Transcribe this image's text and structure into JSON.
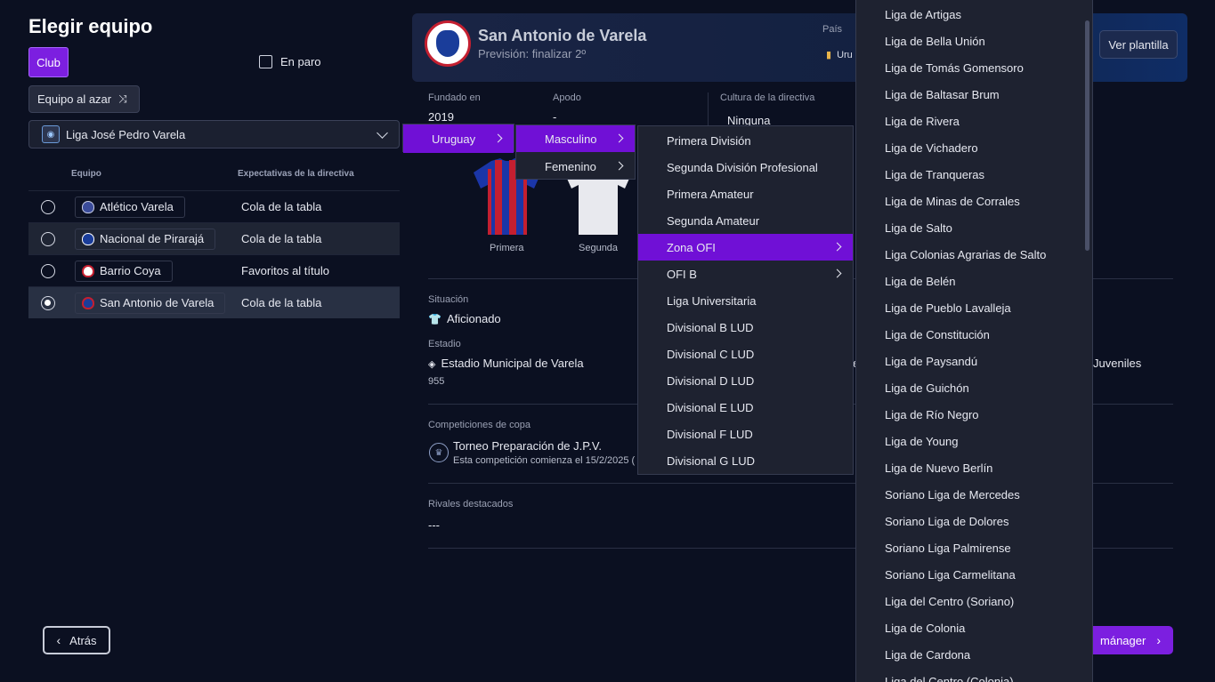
{
  "page": {
    "title": "Elegir equipo",
    "club_chip": "Club",
    "unemployed": "En paro",
    "random_team": "Equipo al azar",
    "league": "Liga José Pedro Varela",
    "back": "Atrás",
    "next": "mánager"
  },
  "table": {
    "col_team": "Equipo",
    "col_expect": "Expectativas de la directiva",
    "rows": [
      {
        "team": "Atlético Varela",
        "expect": "Cola de la tabla",
        "selected": false,
        "crest_color": "#3a4b9a"
      },
      {
        "team": "Nacional de Pirarajá",
        "expect": "Cola de la tabla",
        "selected": false,
        "crest_color": "#1a3d9a"
      },
      {
        "team": "Barrio Coya",
        "expect": "Favoritos al título",
        "selected": false,
        "crest_color": "#c41f30"
      },
      {
        "team": "San Antonio de Varela",
        "expect": "Cola de la tabla",
        "selected": true,
        "crest_color": "#c41f30"
      }
    ]
  },
  "club": {
    "name": "San Antonio de Varela",
    "prediction": "Previsión: finalizar 2º",
    "country_label": "País",
    "country_value": "Uru",
    "view_squad": "Ver plantilla",
    "founded_label": "Fundado en",
    "founded_value": "2019",
    "nickname_label": "Apodo",
    "nickname_value": "-",
    "culture_label": "Cultura de la directiva",
    "culture_value": "Ninguna",
    "kit_home": "Primera",
    "kit_away": "Segunda",
    "status_label": "Situación",
    "status_value": "Aficionado",
    "stadium_label": "Estadio",
    "stadium_value": "Estadio Municipal de Varela",
    "capacity": "955",
    "partial_right": "e",
    "youth_partial": "Juveniles",
    "cup_label": "Competiciones de copa",
    "cup_name": "Torneo Preparación de J.P.V.",
    "cup_note": "Esta competición comienza el 15/2/2025 (",
    "rivals_label": "Rivales destacados",
    "rivals_value": "---"
  },
  "menus": {
    "level1": [
      {
        "label": "Uruguay"
      }
    ],
    "level2": [
      {
        "label": "Masculino"
      },
      {
        "label": "Femenino"
      }
    ],
    "level3": [
      {
        "label": "Primera División"
      },
      {
        "label": "Segunda División Profesional"
      },
      {
        "label": "Primera Amateur"
      },
      {
        "label": "Segunda Amateur"
      },
      {
        "label": "Zona OFI"
      },
      {
        "label": "OFI B"
      },
      {
        "label": "Liga Universitaria"
      },
      {
        "label": "Divisional B LUD"
      },
      {
        "label": "Divisional C LUD"
      },
      {
        "label": "Divisional D LUD"
      },
      {
        "label": "Divisional E LUD"
      },
      {
        "label": "Divisional F LUD"
      },
      {
        "label": "Divisional G LUD"
      }
    ],
    "level4": [
      {
        "label": "Liga de Artigas"
      },
      {
        "label": "Liga de Bella Unión"
      },
      {
        "label": "Liga de Tomás Gomensoro"
      },
      {
        "label": "Liga de Baltasar Brum"
      },
      {
        "label": "Liga de Rivera"
      },
      {
        "label": "Liga de Vichadero"
      },
      {
        "label": "Liga de Tranqueras"
      },
      {
        "label": "Liga de Minas de Corrales"
      },
      {
        "label": "Liga de Salto"
      },
      {
        "label": "Liga Colonias Agrarias de Salto"
      },
      {
        "label": "Liga de Belén"
      },
      {
        "label": "Liga de Pueblo Lavalleja"
      },
      {
        "label": "Liga de Constitución"
      },
      {
        "label": "Liga de Paysandú"
      },
      {
        "label": "Liga de Guichón"
      },
      {
        "label": "Liga de Río Negro"
      },
      {
        "label": "Liga de Young"
      },
      {
        "label": "Liga de Nuevo Berlín"
      },
      {
        "label": "Soriano Liga de Mercedes"
      },
      {
        "label": "Soriano Liga de Dolores"
      },
      {
        "label": "Soriano Liga Palmirense"
      },
      {
        "label": "Soriano Liga Carmelitana"
      },
      {
        "label": "Liga del Centro (Soriano)"
      },
      {
        "label": "Liga de Colonia"
      },
      {
        "label": "Liga de Cardona"
      },
      {
        "label": "Liga del Centro (Colonia)"
      }
    ]
  },
  "colors": {
    "accent": "#7c1fe0",
    "background": "#0b1021",
    "menu_bg": "#1e2230"
  }
}
